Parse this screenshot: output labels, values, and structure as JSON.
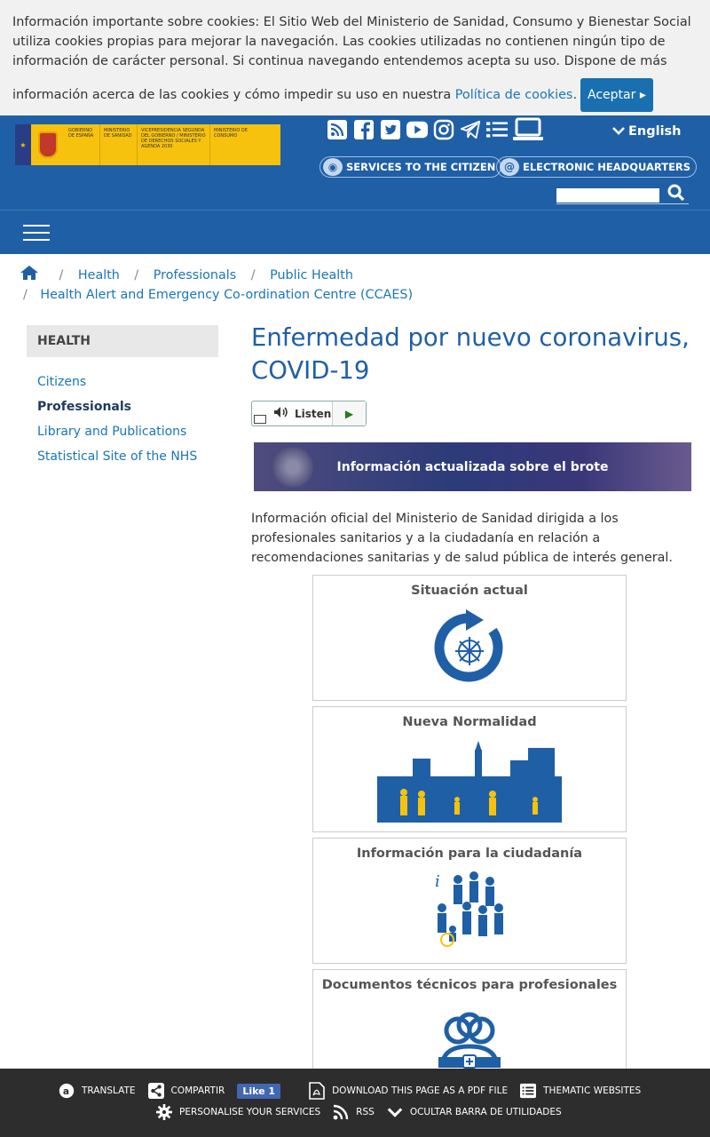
{
  "cookie": {
    "text1": "Información importante sobre cookies: El Sitio Web del Ministerio de Sanidad, Consumo y Bienestar Social utiliza cookies propias para mejorar la navegación. Las cookies utilizadas no contienen ningún tipo de información de carácter personal. Si continua navegando entendemos acepta su uso. Dispone de más",
    "text2": "información acerca de las cookies y cómo impedir su uso en nuestra",
    "link": "Política de cookies",
    "dot": ".",
    "accept": "Aceptar"
  },
  "header": {
    "logo": {
      "gobierno": "GOBIERNO DE ESPAÑA",
      "ministerio": "MINISTERIO DE SANIDAD",
      "vice": "VICEPRESIDENCIA SEGUNDA DEL GOBIERNO / MINISTERIO DE DERECHOS SOCIALES Y AGENDA 2030",
      "consumo": "MINISTERIO DE CONSUMO"
    },
    "language": "English",
    "services": "SERVICES TO THE CITIZEN",
    "electronic": "ELECTRONIC HEADQUARTERS",
    "search_placeholder": ""
  },
  "breadcrumb": {
    "items": [
      "Health",
      "Professionals",
      "Public Health"
    ],
    "last": "Health Alert and Emergency Co-ordination Centre (CCAES)"
  },
  "sidebar": {
    "heading": "HEALTH",
    "items": [
      "Citizens",
      "Professionals",
      "Library and Publications",
      "Statistical Site of the NHS"
    ]
  },
  "main": {
    "title": "Enfermedad por nuevo coronavirus, COVID-19",
    "listen": "Listen",
    "banner": "Información actualizada sobre el brote",
    "intro": "Información oficial del Ministerio de Sanidad dirigida a los profesionales sanitarios y a la ciudadanía en relación a recomendaciones sanitarias y de salud pública de interés general.",
    "cards": [
      "Situación actual",
      "Nueva Normalidad",
      "Información para la ciudadanía",
      "Documentos técnicos para profesionales"
    ]
  },
  "utility": {
    "translate": "TRANSLATE",
    "share": "COMPARTIR",
    "fb": "Like 1",
    "pdf": "DOWNLOAD THIS PAGE AS A PDF FILE",
    "thematic": "THEMATIC WEBSITES",
    "personalise": "PERSONALISE YOUR SERVICES",
    "rss": "RSS",
    "hide": "OCULTAR BARRA DE UTILIDADES"
  },
  "colors": {
    "header_bg": "#1f5fa6",
    "link": "#1976b8",
    "util_bg": "#2d2d2d",
    "card_icon": "#1f5fa6"
  }
}
